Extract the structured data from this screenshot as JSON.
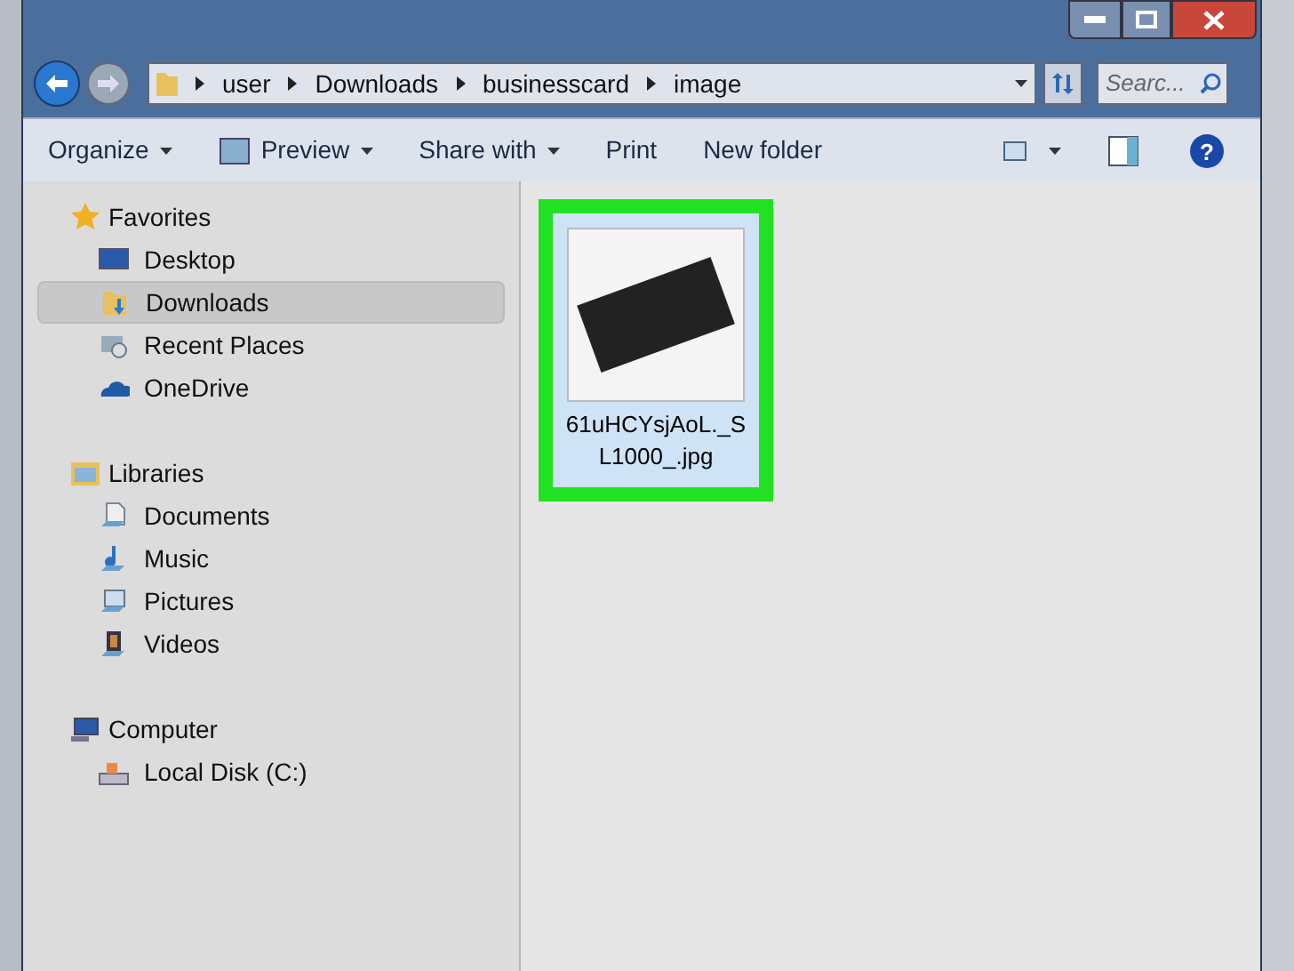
{
  "address_bar": {
    "path": [
      "user",
      "Downloads",
      "businesscard",
      "image"
    ]
  },
  "search": {
    "placeholder": "Searc..."
  },
  "toolbar": [
    {
      "label": "Organize",
      "kind": "menu"
    },
    {
      "label": "Preview",
      "kind": "preview"
    },
    {
      "label": "Share with",
      "kind": "menu"
    },
    {
      "label": "Print",
      "kind": "plain"
    },
    {
      "label": "New folder",
      "kind": "plain"
    }
  ],
  "sidebar": {
    "groups": [
      {
        "label": "Favorites",
        "kind": "star",
        "items": [
          {
            "label": "Desktop",
            "kind": "desktop",
            "selected": false
          },
          {
            "label": "Downloads",
            "kind": "downloads",
            "selected": true
          },
          {
            "label": "Recent Places",
            "kind": "recent",
            "selected": false
          },
          {
            "label": "OneDrive",
            "kind": "cloud",
            "selected": false
          }
        ]
      },
      {
        "label": "Libraries",
        "kind": "library",
        "items": [
          {
            "label": "Documents",
            "kind": "documents",
            "selected": false
          },
          {
            "label": "Music",
            "kind": "music",
            "selected": false
          },
          {
            "label": "Pictures",
            "kind": "pictures",
            "selected": false
          },
          {
            "label": "Videos",
            "kind": "videos",
            "selected": false
          }
        ]
      },
      {
        "label": "Computer",
        "kind": "computer",
        "items": [
          {
            "label": "Local Disk (C:)",
            "kind": "disk",
            "selected": false
          }
        ]
      }
    ]
  },
  "help": {
    "glyph": "?"
  },
  "files": [
    {
      "name": "61uHCYsjAoL._SL1000_.jpg",
      "selected": true
    }
  ]
}
